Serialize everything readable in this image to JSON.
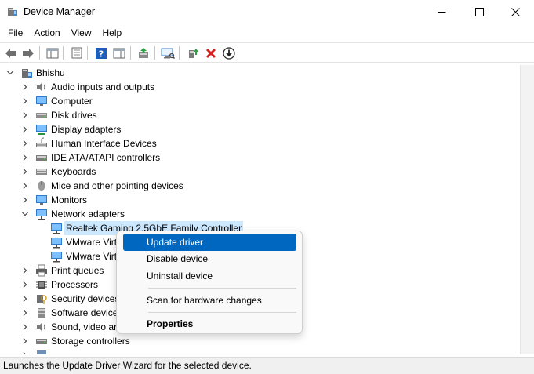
{
  "window": {
    "title": "Device Manager",
    "icons": {
      "app": "device-manager-icon",
      "minimize": "minimize-icon",
      "maximize": "maximize-icon",
      "close": "close-icon"
    }
  },
  "menu": [
    "File",
    "Action",
    "View",
    "Help"
  ],
  "toolbar": [
    "back-icon",
    "forward-icon",
    "show-hide-console-tree-icon",
    "properties-icon",
    "help-icon",
    "action-pane-icon",
    "update-driver-icon",
    "scan-hardware-icon",
    "enable-device-icon",
    "uninstall-device-icon",
    "download-driver-icon"
  ],
  "tree": {
    "root": "Bhishu",
    "items": [
      "Audio inputs and outputs",
      "Computer",
      "Disk drives",
      "Display adapters",
      "Human Interface Devices",
      "IDE ATA/ATAPI controllers",
      "Keyboards",
      "Mice and other pointing devices",
      "Monitors",
      "Network adapters",
      "Realtek Gaming 2.5GbE Family Controller",
      "VMware Virt",
      "VMware Virt",
      "Print queues",
      "Processors",
      "Security devices",
      "Software device",
      "Sound, video ar",
      "Storage controllers"
    ]
  },
  "context_menu": {
    "update_driver": "Update driver",
    "disable_device": "Disable device",
    "uninstall_device": "Uninstall device",
    "scan_hardware": "Scan for hardware changes",
    "properties": "Properties"
  },
  "status": "Launches the Update Driver Wizard for the selected device.",
  "colors": {
    "highlight": "#0067c0",
    "selection": "#cce8ff",
    "accent_blue": "#1e78c8"
  }
}
